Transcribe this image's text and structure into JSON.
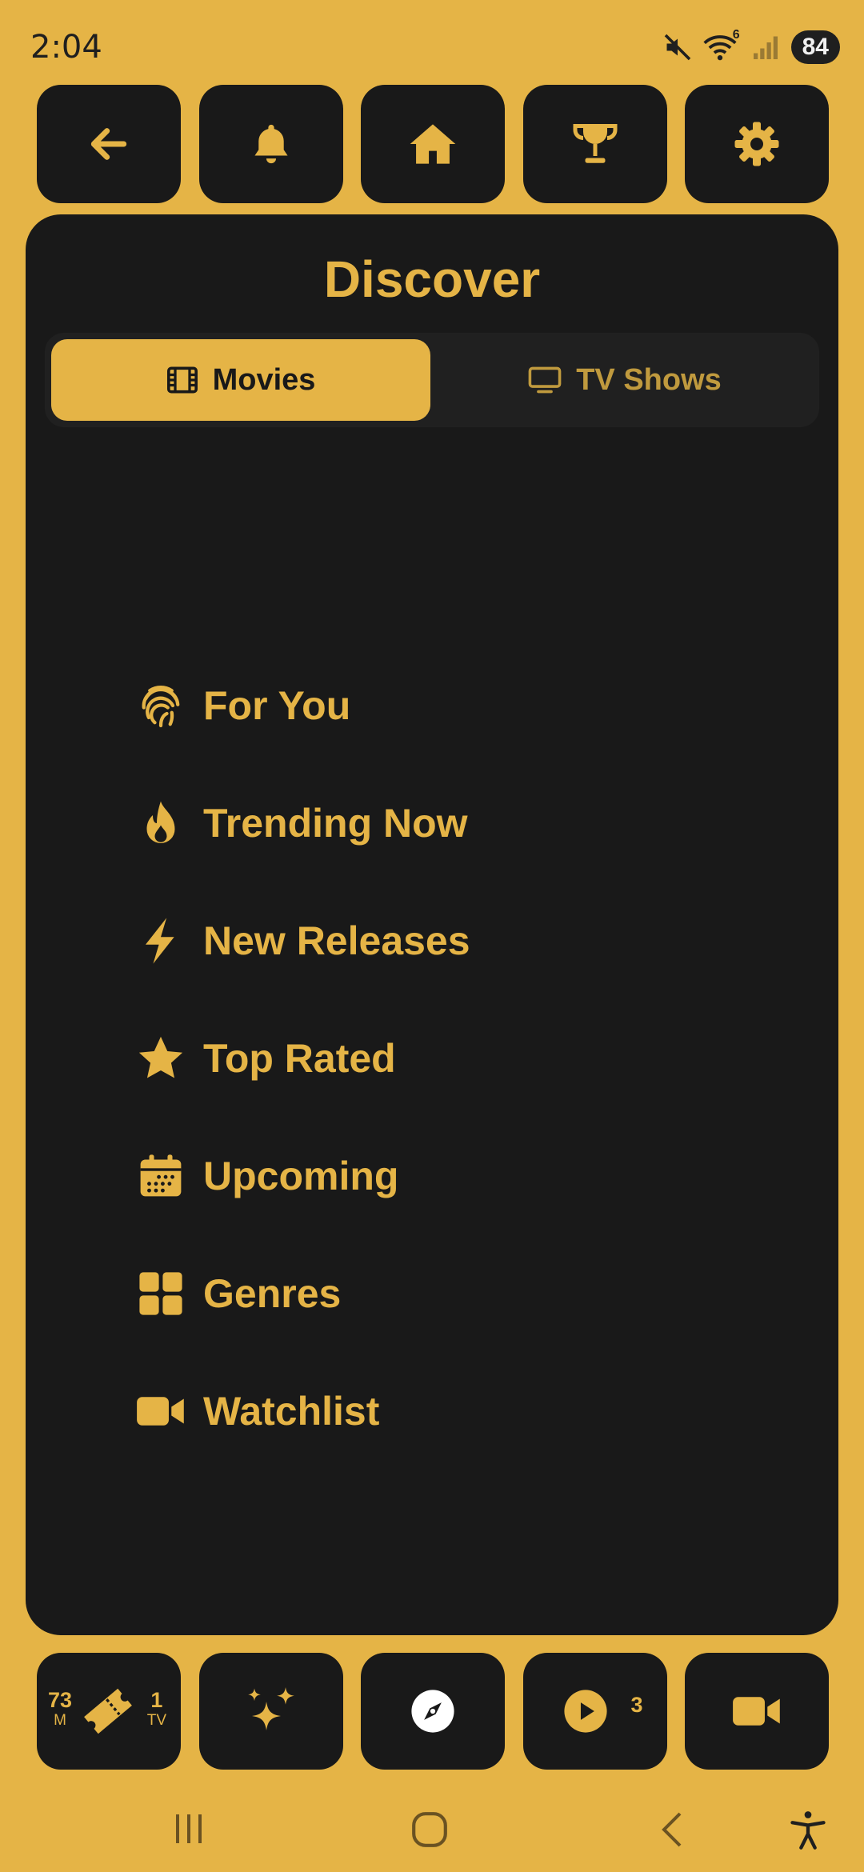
{
  "status": {
    "time": "2:04",
    "battery": "84",
    "wifi_badge": "6"
  },
  "header": {
    "title": "Discover",
    "tabs": [
      {
        "label": "Movies",
        "icon": "film-icon",
        "active": true
      },
      {
        "label": "TV Shows",
        "icon": "tv-icon",
        "active": false
      }
    ]
  },
  "top_nav": [
    "back-arrow-icon",
    "bell-icon",
    "home-icon",
    "trophy-icon",
    "gear-icon"
  ],
  "menu": [
    {
      "label": "For You",
      "icon": "fingerprint-icon"
    },
    {
      "label": "Trending Now",
      "icon": "flame-icon"
    },
    {
      "label": "New Releases",
      "icon": "lightning-icon"
    },
    {
      "label": "Top Rated",
      "icon": "star-icon"
    },
    {
      "label": "Upcoming",
      "icon": "calendar-icon"
    },
    {
      "label": "Genres",
      "icon": "grid-icon"
    },
    {
      "label": "Watchlist",
      "icon": "video-camera-icon"
    }
  ],
  "bottom_nav": {
    "tickets": {
      "movies_count": "73",
      "movies_unit": "M",
      "tv_count": "1",
      "tv_unit": "TV"
    },
    "playing_count": "3"
  },
  "colors": {
    "accent": "#E5B446",
    "panel": "#191919",
    "muted_accent": "#C09A3E"
  }
}
